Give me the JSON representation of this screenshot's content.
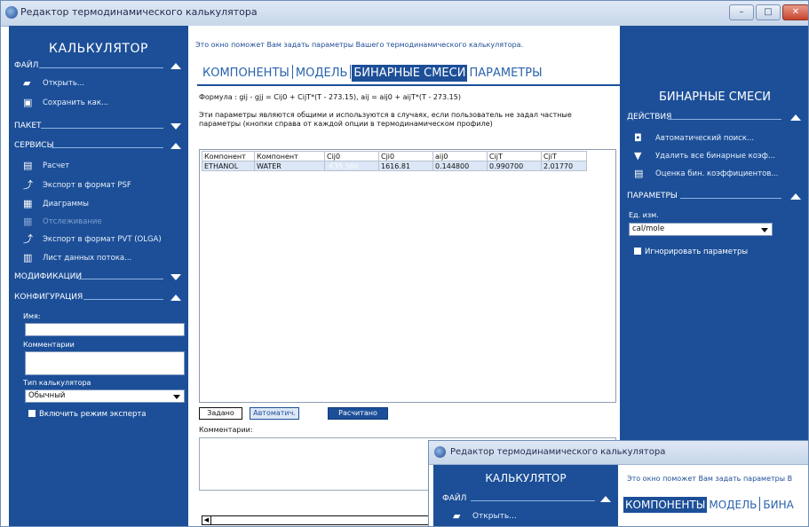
{
  "window": {
    "title": "Редактор термодинамического калькулятора",
    "controls": {
      "minimize": "–",
      "maximize": "□",
      "close": "✕"
    }
  },
  "left_sidebar": {
    "title": "КАЛЬКУЛЯТОР",
    "sections": {
      "file": {
        "label": "ФАЙЛ",
        "items": [
          "Открыть...",
          "Сохранить как..."
        ]
      },
      "package": {
        "label": "ПАКЕТ"
      },
      "services": {
        "label": "СЕРВИСЫ",
        "items": [
          "Расчет",
          "Экспорт в формат PSF",
          "Диаграммы",
          "Отслеживание",
          "Экспорт в формат PVT (OLGA)",
          "Лист данных потока..."
        ]
      },
      "modifications": {
        "label": "МОДИФИКАЦИИ"
      },
      "configuration": {
        "label": "КОНФИГУРАЦИЯ"
      }
    },
    "config": {
      "name_label": "Имя:",
      "name_value": "",
      "comment_label": "Комментарии",
      "comment_value": "",
      "type_label": "Тип калькулятора",
      "type_value": "Обычный",
      "expert_label": "Включить режим эксперта"
    }
  },
  "main": {
    "intro": "Это окно поможет Вам задать параметры Вашего термодинамического калькулятора.",
    "tabs": [
      "КОМПОНЕНТЫ",
      "МОДЕЛЬ",
      "БИНАРНЫЕ СМЕСИ",
      "ПАРАМЕТРЫ"
    ],
    "active_tab": "БИНАРНЫЕ СМЕСИ",
    "formula": "Формула : gij - gjj = Cij0 + CijT*(T - 273.15), aij = aij0 + aijT*(T - 273.15)",
    "description": "Эти параметры являются общими и используются в случаях, если пользователь не задал частные параметры (кнопки справа от каждой опции в термодинамическом профиле)",
    "table": {
      "headers": [
        "Компонент",
        "Компонент",
        "Cij0",
        "Cji0",
        "aij0",
        "CijT",
        "CjiT"
      ],
      "rows": [
        [
          "ETHANOL",
          "WATER",
          "-635.560",
          "1616.81",
          "0.144800",
          "0.990700",
          "2.01770"
        ]
      ]
    },
    "buttons": {
      "set": "Задано",
      "auto": "Автоматич.",
      "calculated": "Расчитано"
    },
    "comment_label": "Комментарии:",
    "comment_value": ""
  },
  "right_sidebar": {
    "title": "БИНАРНЫЕ СМЕСИ",
    "actions_label": "ДЕЙСТВИЯ",
    "actions": [
      "Автоматический поиск...",
      "Удалить все бинарные коэф...",
      "Оценка бин. коэффициентов..."
    ],
    "params_label": "ПАРАМЕТРЫ",
    "units_label": "Ед. изм.",
    "units_value": "cal/mole",
    "ignore_label": "Игнорировать параметры"
  },
  "overlay_window": {
    "title": "Редактор термодинамического калькулятора",
    "sidebar_title": "КАЛЬКУЛЯТОР",
    "file_label": "ФАЙЛ",
    "open_label": "Открыть...",
    "intro": "Это окно поможет Вам задать параметры В",
    "tabs": [
      "КОМПОНЕНТЫ",
      "МОДЕЛЬ",
      "БИНА"
    ]
  },
  "colors": {
    "sidebar": "#1c4f98",
    "accent": "#2a63ad",
    "selection": "#3569b3"
  }
}
